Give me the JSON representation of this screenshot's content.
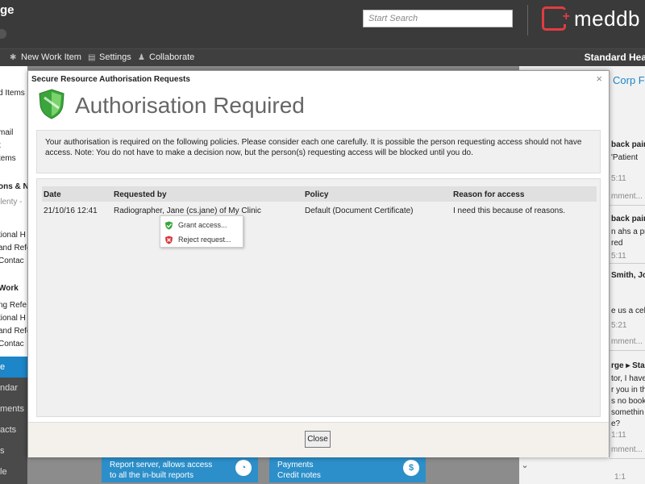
{
  "app": {
    "title": "ge"
  },
  "search": {
    "placeholder": "Start Search"
  },
  "logo": {
    "text": "meddb"
  },
  "toolbar": {
    "new_work_item": "New Work Item",
    "settings": "Settings",
    "collaborate": "Collaborate",
    "right_text": "Standard Hea"
  },
  "sidebar": {
    "items": [
      "d Items",
      "mail",
      "t",
      "tems",
      "ons & Ne",
      "llenty -",
      "tional H",
      "and Refe",
      "Contac",
      "Work",
      "ng Refe",
      "tional H",
      "and Refe",
      "Contac"
    ],
    "dark_items": [
      "e",
      "ndar",
      "ments",
      "acts",
      "s",
      "le"
    ]
  },
  "tiles": [
    {
      "line1": "Report server, allows access",
      "line2": "to all the in-built reports",
      "icon": "pie-chart-icon"
    },
    {
      "line1": "Payments",
      "line2": "Credit notes",
      "icon": "money-bag-icon"
    }
  ],
  "feed": {
    "header": "Corp Fe",
    "lines": [
      {
        "text": "back pair",
        "style": "bold"
      },
      {
        "text": "'Patient",
        "style": ""
      },
      {
        "text": "5:11",
        "style": "muted"
      },
      {
        "text": "mment...",
        "style": "muted"
      },
      {
        "text": "back pair",
        "style": "bold"
      },
      {
        "text": "n ahs a pr",
        "style": ""
      },
      {
        "text": "red",
        "style": ""
      },
      {
        "text": "5:11",
        "style": "muted"
      },
      {
        "text": "Smith, Jo",
        "style": "bold"
      },
      {
        "text": "e us a cell",
        "style": ""
      },
      {
        "text": "5:21",
        "style": "muted"
      },
      {
        "text": "mment...",
        "style": "muted"
      },
      {
        "text": "rge ▸ Sta",
        "style": "bold"
      },
      {
        "text": "tor, I have",
        "style": ""
      },
      {
        "text": "r you in th",
        "style": ""
      },
      {
        "text": "s no book",
        "style": ""
      },
      {
        "text": "somethin",
        "style": ""
      },
      {
        "text": "e?",
        "style": ""
      },
      {
        "text": "1:11",
        "style": "muted"
      },
      {
        "text": "mment...",
        "style": "muted"
      }
    ],
    "bottom_time": "1:1"
  },
  "modal": {
    "window_title": "Secure Resource Authorisation Requests",
    "heading": "Authorisation Required",
    "notice": "Your authorisation is required on the following policies. Please consider each one carefully. It is possible the person requesting access should not have access. Note: You do not have to make a decision now, but the person(s) requesting access will be blocked until you do.",
    "columns": {
      "date": "Date",
      "requested_by": "Requested by",
      "policy": "Policy",
      "reason": "Reason for access"
    },
    "rows": [
      {
        "date": "21/10/16 12:41",
        "requested_by": "Radiographer, Jane (cs.jane) of My Clinic",
        "policy": "Default (Document Certificate)",
        "reason": "I need this because of reasons."
      }
    ],
    "context_menu": {
      "grant": "Grant access...",
      "reject": "Reject request..."
    },
    "close_label": "Close"
  },
  "colors": {
    "accent_blue": "#1c86c8",
    "logo_red": "#e23c40",
    "shield_green": "#3aa53a"
  }
}
